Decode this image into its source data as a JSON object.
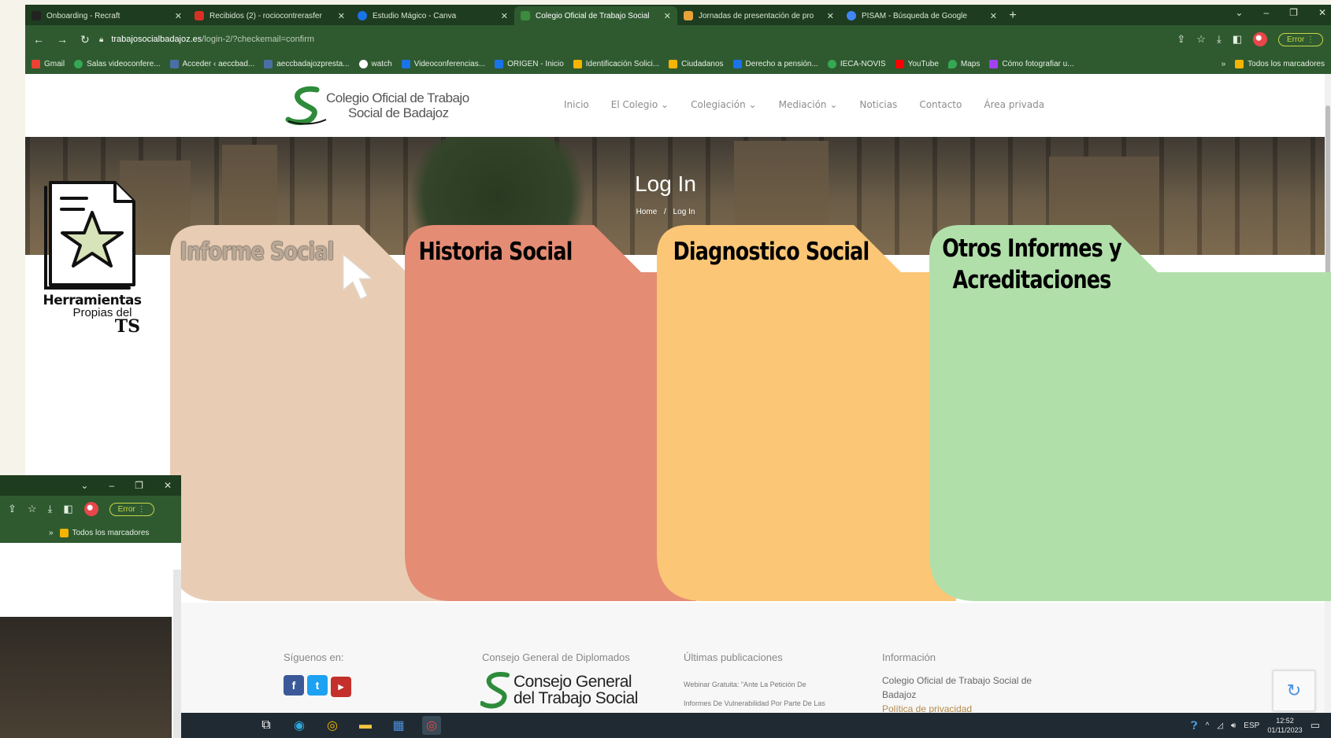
{
  "browser": {
    "tabs": [
      {
        "label": "Onboarding - Recraft",
        "color": "#222222",
        "active": false
      },
      {
        "label": "Recibidos (2) - rociocontrerasfer",
        "color": "#d93025",
        "active": false
      },
      {
        "label": "Estudio Mágico - Canva",
        "color": "#1a73e8",
        "active": false
      },
      {
        "label": "Colegio Oficial de Trabajo Social",
        "color": "#3c8c3e",
        "active": true
      },
      {
        "label": "Jornadas de presentación de pro",
        "color": "#e8a23a",
        "active": false
      },
      {
        "label": "PISAM - Búsqueda de Google",
        "color": "#4285f4",
        "active": false
      }
    ],
    "url_host": "trabajosocialbadajoz.es",
    "url_path": "/login-2/?checkemail=confirm",
    "error_label": "Error",
    "bookmarks": [
      {
        "label": "Gmail",
        "color": "#ea4335"
      },
      {
        "label": "Salas videoconfere...",
        "color": "#34a853"
      },
      {
        "label": "Acceder ‹ aeccbad...",
        "color": "#4a6fa5"
      },
      {
        "label": "aeccbadajozpresta...",
        "color": "#4a6fa5"
      },
      {
        "label": "watch",
        "color": "#ffffff"
      },
      {
        "label": "Videoconferencias...",
        "color": "#1a73e8"
      },
      {
        "label": "ORIGEN - Inicio",
        "color": "#1a73e8"
      },
      {
        "label": "Identificación Solici...",
        "color": "#f4b400"
      },
      {
        "label": "Ciudadanos",
        "color": "#f4b400"
      },
      {
        "label": "Derecho a pensión...",
        "color": "#1a73e8"
      },
      {
        "label": "IECA-NOVIS",
        "color": "#34a853"
      },
      {
        "label": "YouTube",
        "color": "#ff0000"
      },
      {
        "label": "Maps",
        "color": "#34a853"
      },
      {
        "label": "Cómo fotografiar u...",
        "color": "#a142f4"
      }
    ],
    "all_bookmarks": "Todos los marcadores"
  },
  "site": {
    "logo_line1": "Colegio Oficial de Trabajo",
    "logo_line2": "Social de Badajoz",
    "nav": [
      "Inicio",
      "El Colegio ⌄",
      "Colegiación ⌄",
      "Mediación ⌄",
      "Noticias",
      "Contacto",
      "Área privada"
    ],
    "hero_title": "Log In",
    "crumb_home": "Home",
    "crumb_sep": "/",
    "crumb_current": "Log In"
  },
  "footer": {
    "follow": "Síguenos en:",
    "consejo_heading": "Consejo General de Diplomados",
    "consejo_logo_l1": "Consejo General",
    "consejo_logo_l2": "del Trabajo Social",
    "latest_heading": "Últimas publicaciones",
    "latest_l1": "Webinar Gratuita: \"Ante La Petición De",
    "latest_l2": "Informes De Vulnerabilidad Por Parte De Las",
    "info_heading": "Información",
    "info_l1": "Colegio Oficial de Trabajo Social de",
    "info_l2": "Badajoz",
    "info_l3": "Política de privacidad"
  },
  "overlay": {
    "tool_line1": "Herramientas",
    "tool_line2": "Propias del",
    "tool_line3": "TS",
    "folders": [
      {
        "title": "Informe Social",
        "color": "#e8cdb4"
      },
      {
        "title": "Historia Social",
        "color": "#e58c75"
      },
      {
        "title": "Diagnostico Social",
        "color": "#fbc676"
      },
      {
        "title": "Otros Informes y Acreditaciones",
        "color": "#b1dfaa"
      }
    ]
  },
  "second_window": {
    "error_label": "Error",
    "all_bookmarks": "Todos los marcadores"
  },
  "taskbar": {
    "lang": "ESP",
    "time": "12:52",
    "date": "01/11/2023"
  }
}
